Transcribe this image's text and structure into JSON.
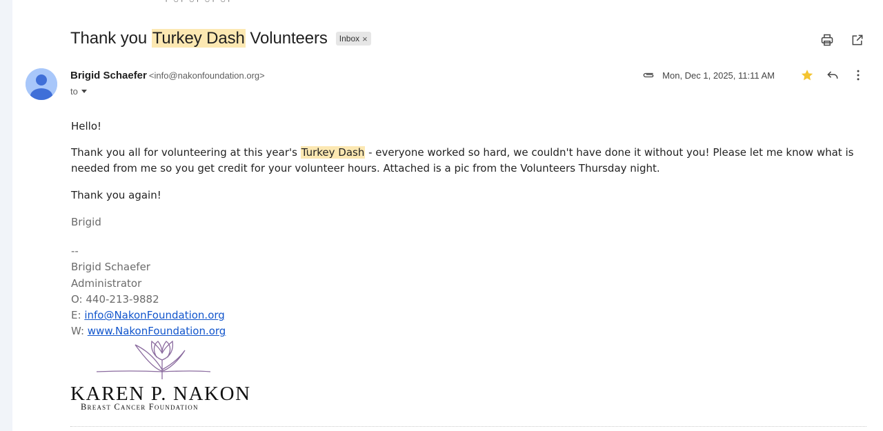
{
  "subject": {
    "before": "Thank you ",
    "highlight": "Turkey Dash",
    "after": " Volunteers",
    "label_chip": "Inbox",
    "label_remove": "×"
  },
  "toolbar": {
    "print_icon": "printer-icon",
    "popout_icon": "open-in-new-window-icon"
  },
  "message": {
    "sender_name": "Brigid Schaefer",
    "sender_email": "<info@nakonfoundation.org>",
    "to_label": "to",
    "date": "Mon, Dec 1, 2025, 11:11 AM",
    "has_attachment": true,
    "starred": true,
    "star_color": "#f4c430",
    "highlight_color": "#fce8b2"
  },
  "body": {
    "greeting": "Hello!",
    "para1_before": "Thank you all for volunteering at this year's ",
    "para1_highlight": "Turkey Dash",
    "para1_after": " - everyone worked so hard, we couldn't have done it without you! Please let me know what is needed from me so you get credit for your volunteer hours. Attached is a pic from the Volunteers Thursday night.",
    "thanks": "Thank you again!",
    "sign": "Brigid"
  },
  "signature": {
    "separator": "--",
    "name": "Brigid Schaefer",
    "title": "Administrator",
    "phone": "O: 440-213-9882",
    "email_prefix": "E: ",
    "email_link": "info@NakonFoundation.org",
    "web_prefix": "W: ",
    "web_link": "www.NakonFoundation.org"
  },
  "logo": {
    "title": "KAREN P. NAKON",
    "subtitle": "Breast Cancer Foundation",
    "icon": "tulip-icon",
    "accent": "#8a6a9e"
  }
}
